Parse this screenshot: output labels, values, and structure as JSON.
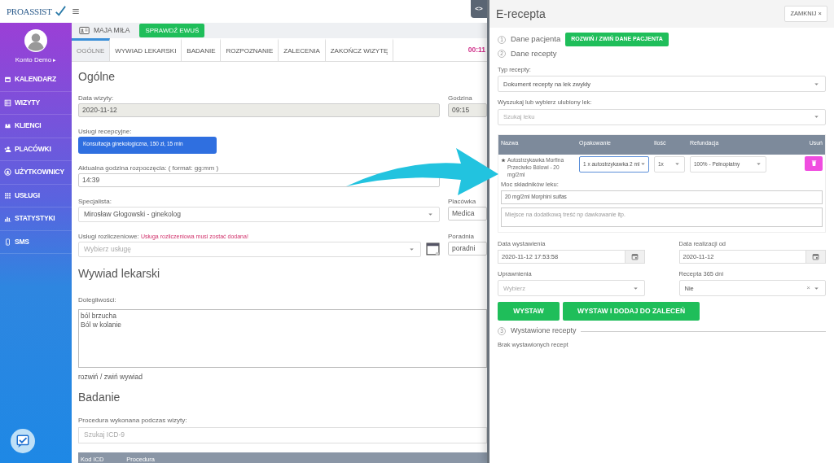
{
  "header": {
    "logo": "PROASSIST",
    "toggle": "<>"
  },
  "sidebar": {
    "user": "Konto Demo",
    "user_arrow": "▸",
    "items": [
      {
        "label": "KALENDARZ",
        "kind": "calendar"
      },
      {
        "label": "WIZYTY",
        "kind": "table"
      },
      {
        "label": "KLIENCI",
        "kind": "people"
      },
      {
        "label": "PLACÓWKI",
        "kind": "person-add"
      },
      {
        "label": "UŻYTKOWNICY",
        "kind": "user-circle"
      },
      {
        "label": "USŁUGI",
        "kind": "grid"
      },
      {
        "label": "STATYSTYKI",
        "kind": "bars"
      },
      {
        "label": "SMS",
        "kind": "phone"
      }
    ]
  },
  "patient_bar": {
    "name": "MAJA MIŁA",
    "button": "SPRAWDŹ EWUŚ"
  },
  "tabs": [
    {
      "label": "OGÓLNE",
      "selected": true
    },
    {
      "label": "WYWIAD LEKARSKI",
      "selected": false
    },
    {
      "label": "BADANIE",
      "selected": false
    },
    {
      "label": "ROZPOZNANIE",
      "selected": false
    },
    {
      "label": "ZALECENIA",
      "selected": false
    },
    {
      "label": "ZAKOŃCZ WIZYTĘ",
      "selected": false
    }
  ],
  "timer": "00:11",
  "general": {
    "title": "Ogólne",
    "rows": [
      {
        "left": {
          "kind": "input",
          "label": "Data wizyty:",
          "value": "2020-11-12",
          "disabled": true
        },
        "right": {
          "kind": "input",
          "label": "Godzina",
          "value": "09:15",
          "disabled": true
        }
      },
      {
        "left": {
          "kind": "chip",
          "label": "Usługi recepcyjne:",
          "value": "Konsultacja ginekologiczna, 150 zł, 15 min"
        }
      },
      {
        "left": {
          "kind": "input",
          "label": "Aktualna godzina rozpoczęcia: ( format: gg:mm )",
          "value": "14:39",
          "disabled": false
        }
      },
      {
        "left": {
          "kind": "select",
          "label": "Specjalista:",
          "value": "Mirosław Głogowski - ginekolog"
        },
        "right": {
          "kind": "input",
          "label": "Placówka",
          "value": "Medica",
          "disabled": false
        }
      },
      {
        "left": {
          "kind": "select_icon",
          "label": "Usługi rozliczeniowe:",
          "warning": "Usługa rozliczeniowa musi zostać dodana!",
          "placeholder": "Wybierz usługę"
        },
        "right": {
          "kind": "input",
          "label": "Poradnia",
          "value": "poradni",
          "disabled": false
        }
      }
    ]
  },
  "interview": {
    "title": "Wywiad lekarski",
    "label": "Dolegliwości:",
    "lines": [
      "ból brzucha",
      "Ból w kolanie"
    ],
    "toggle": "rozwiń / zwiń wywiad"
  },
  "exam": {
    "title": "Badanie",
    "label": "Procedura wykonana podczas wizyty:",
    "placeholder": "Szukaj ICD-9",
    "columns": [
      "Kod ICD",
      "Procedura"
    ]
  },
  "panel": {
    "title": "E-recepta",
    "close": "ZAMKNIJ ×",
    "steps": [
      {
        "number": "1",
        "label": "Dane pacjenta",
        "button": "ROZWIŃ / ZWIŃ DANE PACJENTA"
      },
      {
        "number": "2",
        "label": "Dane recepty"
      }
    ],
    "type": {
      "label": "Typ recepty:",
      "value": "Dokument recepty na lek zwykły"
    },
    "search": {
      "label": "Wyszukaj lub wybierz ulubiony lek:",
      "placeholder": "Szukaj leku"
    },
    "table": {
      "columns": [
        "Nazwa",
        "Opakowanie",
        "Ilość",
        "Refundacja",
        "Usuń"
      ],
      "row": {
        "favorite": true,
        "name": "Autostrzykawka Morfina Przeciwko Bólowi - 20 mg/2ml",
        "package": "1 x autostrzykawka 2 ml",
        "package_focused": true,
        "quantity": "1x",
        "refund": "100% - Pełnopłatny"
      },
      "strength_label": "Moc składników leku:",
      "strength": "20 mg/2ml Morphini sulfas",
      "notes_placeholder": "Miejsce na dodatkową treść np dawkowanie itp."
    },
    "issue_date": {
      "label": "Data wystawienia",
      "value": "2020-11-12 17:53:58"
    },
    "realization_date": {
      "label": "Data realizacji od",
      "value": "2020-11-12"
    },
    "permissions": {
      "label": "Uprawnienia",
      "placeholder": "Wybierz"
    },
    "recipe365": {
      "label": "Recepta 365 dni",
      "value": "Nie",
      "clear": "×"
    },
    "buttons": [
      "WYSTAW",
      "WYSTAW I DODAJ DO ZALECEŃ"
    ],
    "issued": {
      "number": "3",
      "label": "Wystawione recepty",
      "empty": "Brak wystawionych recept"
    }
  }
}
